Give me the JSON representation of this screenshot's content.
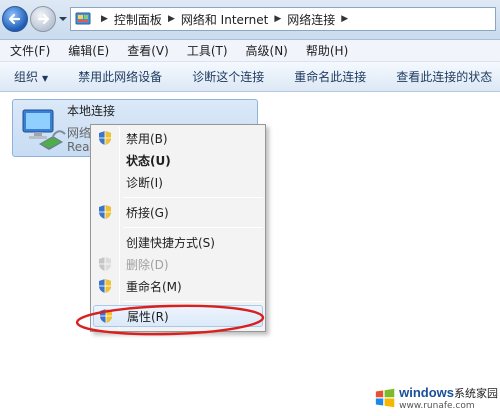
{
  "address_bar": {
    "breadcrumbs": [
      "控制面板",
      "网络和 Internet",
      "网络连接"
    ]
  },
  "menu_bar": {
    "items": [
      "文件(F)",
      "编辑(E)",
      "查看(V)",
      "工具(T)",
      "高级(N)",
      "帮助(H)"
    ]
  },
  "command_bar": {
    "items": [
      "组织",
      "禁用此网络设备",
      "诊断这个连接",
      "重命名此连接",
      "查看此连接的状态"
    ]
  },
  "connection": {
    "name": "本地连接",
    "status_partial": "网络",
    "device_partial": "Rea"
  },
  "context_menu": {
    "items": [
      {
        "label": "禁用(B)",
        "icon": "shield-icon"
      },
      {
        "label": "状态(U)",
        "bold": true
      },
      {
        "label": "诊断(I)"
      },
      {
        "label": "桥接(G)",
        "icon": "shield-icon"
      },
      {
        "label": "创建快捷方式(S)"
      },
      {
        "label": "删除(D)",
        "icon": "shield-icon",
        "disabled": true
      },
      {
        "label": "重命名(M)",
        "icon": "shield-icon"
      },
      {
        "label": "属性(R)",
        "icon": "shield-icon"
      }
    ]
  },
  "annotation": {
    "color": "#d9201e"
  },
  "watermark": {
    "brand": "windows",
    "suffix": "系统家园",
    "url": "www.runafe.com"
  }
}
